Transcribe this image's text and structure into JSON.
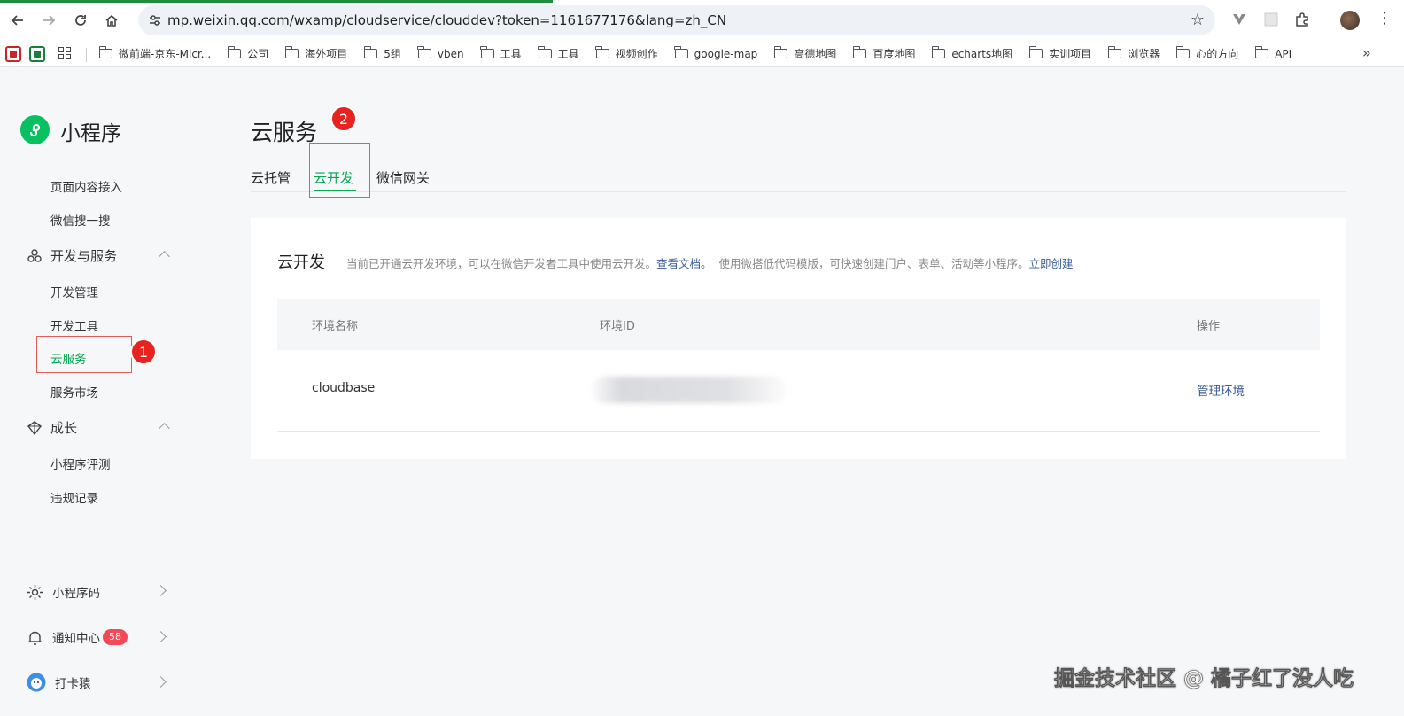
{
  "browser": {
    "url": "mp.weixin.qq.com/wxamp/cloudservice/clouddev?token=1161677176&lang=zh_CN",
    "nav_icons": [
      "back-arrow-icon",
      "forward-arrow-icon",
      "reload-icon",
      "home-icon"
    ],
    "bookmarks": [
      "微前端-京东-Micr...",
      "公司",
      "海外项目",
      "5组",
      "vben",
      "工具",
      "工具",
      "视频创作",
      "google-map",
      "高德地图",
      "百度地图",
      "echarts地图",
      "实训项目",
      "浏览器",
      "心的方向",
      "API"
    ]
  },
  "sidebar": {
    "app_name": "小程序",
    "items_top": [
      "页面内容接入",
      "微信搜一搜"
    ],
    "group_dev": "开发与服务",
    "items_dev": [
      "开发管理",
      "开发工具",
      "云服务",
      "服务市场"
    ],
    "group_growth": "成长",
    "items_growth": [
      "小程序评测",
      "违规记录"
    ],
    "bottom": {
      "qrcode": "小程序码",
      "notice": "通知中心",
      "notice_count": "58",
      "user": "打卡猿"
    }
  },
  "annotations": {
    "step1": "1",
    "step2": "2"
  },
  "main": {
    "title": "云服务",
    "tabs": [
      "云托管",
      "云开发",
      "微信网关"
    ],
    "active_tab": "云开发",
    "card": {
      "title": "云开发",
      "desc1": "当前已开通云开发环境，可以在微信开发者工具中使用云开发。",
      "link_docs": "查看文档。",
      "desc2": "使用微搭低代码模版，可快速创建门户、表单、活动等小程序。",
      "link_create": "立即创建",
      "columns": [
        "环境名称",
        "环境ID",
        "操作"
      ],
      "rows": [
        {
          "name": "cloudbase",
          "action": "管理环境"
        }
      ]
    }
  },
  "watermark": "掘金技术社区 @ 橘子红了没人吃",
  "colors": {
    "accent": "#07c160",
    "link": "#3a5b9a",
    "annotation": "#e8231f"
  }
}
